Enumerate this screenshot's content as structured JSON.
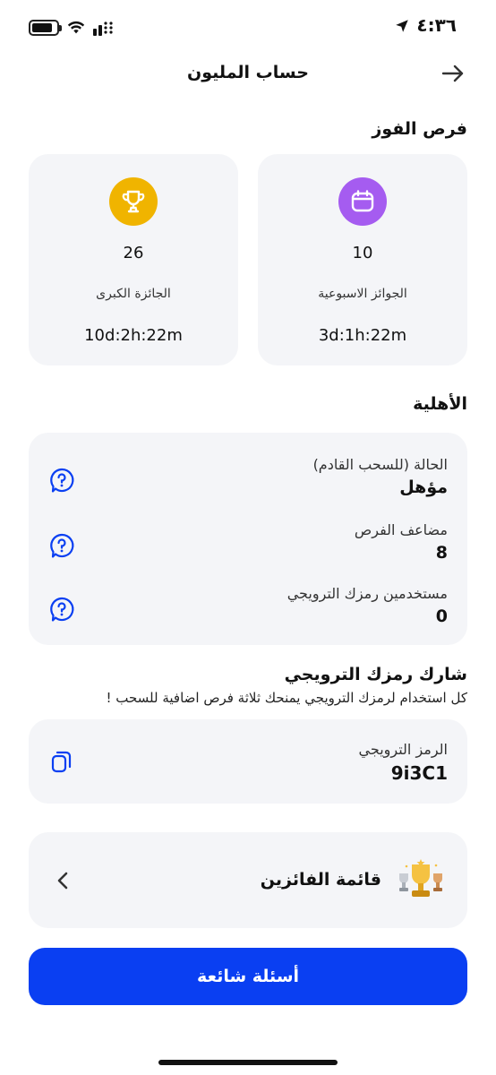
{
  "status_bar": {
    "time": "٤:٣٦",
    "battery_level": 0.85
  },
  "header": {
    "title": "حساب المليون",
    "back_icon": "arrow-right-icon"
  },
  "chances": {
    "title": "فرص الفوز",
    "cards": [
      {
        "count": "10",
        "label": "الجوائز الاسبوعية",
        "time": "3d:1h:22m",
        "icon": "calendar-icon",
        "color": "#a55cf0"
      },
      {
        "count": "26",
        "label": "الجائزة الكبرى",
        "time": "10d:2h:22m",
        "icon": "trophy-icon",
        "color": "#f0b400"
      }
    ]
  },
  "eligibility": {
    "title": "الأهلية",
    "rows": [
      {
        "label": "الحالة (للسحب القادم)",
        "value": "مؤهل"
      },
      {
        "label": "مضاعف الفرص",
        "value": "8"
      },
      {
        "label": "مستخدمين رمزك الترويجي",
        "value": "0"
      }
    ],
    "help_color": "#0a3ff2"
  },
  "share": {
    "title": "شارك رمزك الترويجي",
    "subtitle": "كل استخدام لرمزك الترويجي يمنحك ثلاثة فرص اضافية للسحب !",
    "code_label": "الرمز الترويجي",
    "code": "9i3C1"
  },
  "winners": {
    "label": "قائمة الفائزين"
  },
  "faq": {
    "label": "أسئلة شائعة"
  },
  "colors": {
    "accent": "#0a3ff2",
    "card_bg": "#f4f5f8"
  }
}
